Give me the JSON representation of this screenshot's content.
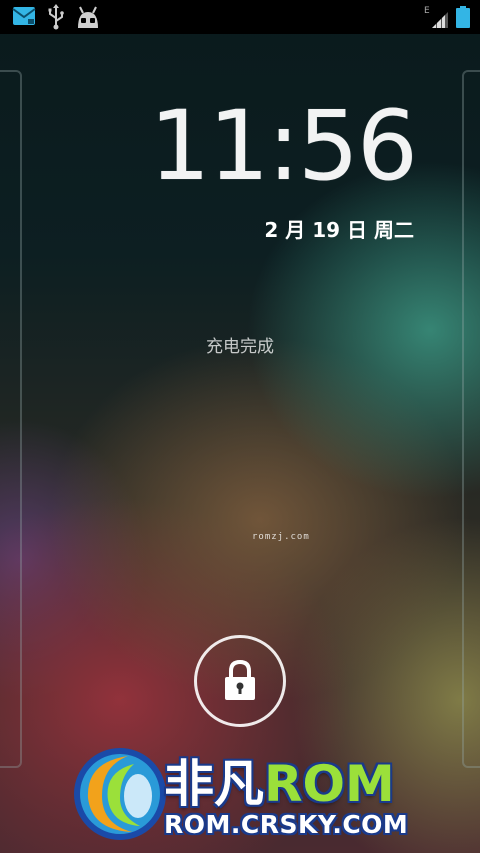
{
  "status_bar": {
    "icons_left": [
      "gmail-icon",
      "usb-icon",
      "android-robot-icon"
    ],
    "icons_right": [
      "signal-icon",
      "battery-icon"
    ],
    "network_type": "E"
  },
  "lockscreen": {
    "time_hour": "11",
    "time_sep": ":",
    "time_min": "56",
    "date": "2 月 19 日 周二",
    "charge_status": "充电完成",
    "center_watermark": "romzj.com",
    "unlock_icon": "lock-icon"
  },
  "watermark_logo": {
    "title_cn": "非凡",
    "title_rom": "ROM",
    "url": "ROM.CRSKY.COM"
  },
  "colors": {
    "accent_blue": "#33b5e5",
    "logo_green": "#9be03a",
    "logo_outline": "#1a3a8a"
  }
}
